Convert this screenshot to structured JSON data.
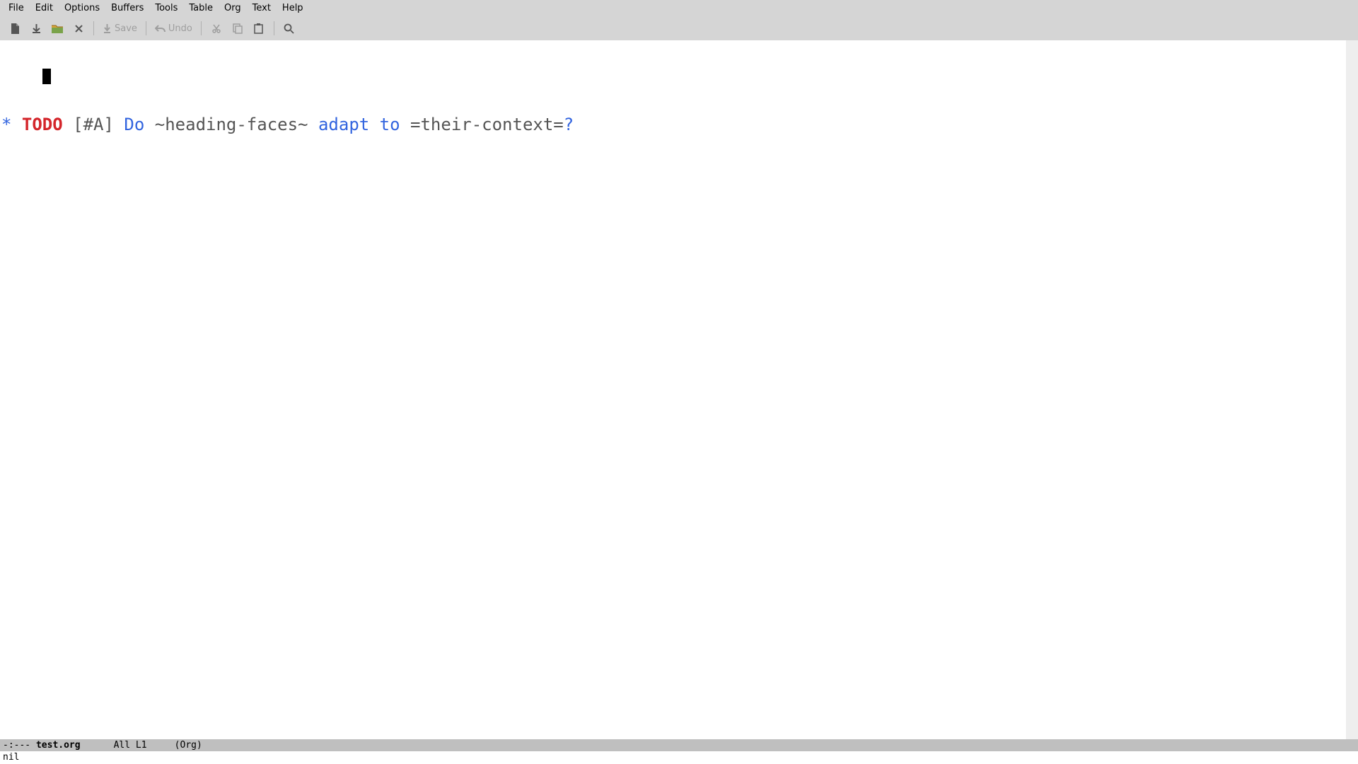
{
  "menubar": {
    "items": [
      "File",
      "Edit",
      "Options",
      "Buffers",
      "Tools",
      "Table",
      "Org",
      "Text",
      "Help"
    ]
  },
  "toolbar": {
    "save_label": "Save",
    "undo_label": "Undo"
  },
  "content": {
    "line1": {
      "star": "*",
      "todo": "TODO",
      "priority": "[#A]",
      "head_pre": "Do ",
      "code": "~heading-faces~",
      "head_mid1": " ",
      "head_blue2": "adapt to",
      "head_mid2": " ",
      "verbatim": "=their-context=",
      "head_q": "?"
    }
  },
  "modeline": {
    "left": "-:--- ",
    "buffer": "test.org",
    "gap1": "      ",
    "pos": "All L1",
    "gap2": "     ",
    "mode": "(Org)"
  },
  "echo": {
    "text": "nil"
  }
}
